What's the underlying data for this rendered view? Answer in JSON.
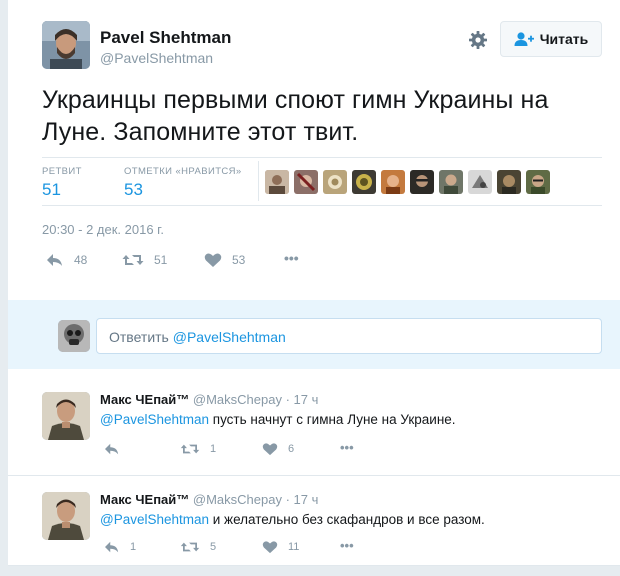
{
  "author": {
    "name": "Pavel Shehtman",
    "handle": "@PavelShehtman",
    "avatar": "author-avatar"
  },
  "follow_button": {
    "label": "Читать",
    "icon": "follow-person-icon"
  },
  "settings_icon": "gear-icon",
  "tweet": {
    "text": "Украинцы первыми споют гимн Украины на Луне. Запомните этот твит.",
    "retweets_label": "РЕТВИТ",
    "retweets_value": "51",
    "likes_label": "ОТМЕТКИ «НРАВИТСЯ»",
    "likes_value": "53",
    "timestamp": "20:30 - 2 дек. 2016 г.",
    "actions": {
      "reply_count": "48",
      "retweet_count": "51",
      "like_count": "53",
      "more": "•••"
    }
  },
  "likers_avatars": [
    "liker-1",
    "liker-2",
    "liker-3",
    "liker-4",
    "liker-5",
    "liker-6",
    "liker-7",
    "liker-8",
    "liker-9"
  ],
  "reply_box": {
    "placeholder_prefix": "Ответить ",
    "placeholder_mention": "@PavelShehtman"
  },
  "replies": [
    {
      "name": "Макс ЧЕпай™",
      "handle": "@MaksChepay",
      "time": "· 17 ч",
      "mention": "@PavelShehtman",
      "text": " пусть начнут с гимна Луне на Украине.",
      "reply_count": "",
      "retweet_count": "1",
      "like_count": "6",
      "more": "•••"
    },
    {
      "name": "Макс ЧЕпай™",
      "handle": "@MaksChepay",
      "time": "· 17 ч",
      "mention": "@PavelShehtman",
      "text": " и желательно без скафандров и все разом.",
      "reply_count": "1",
      "retweet_count": "5",
      "like_count": "11",
      "more": "•••"
    }
  ],
  "colors": {
    "link": "#1b95e0",
    "muted": "#8899a6",
    "text": "#14171a"
  }
}
